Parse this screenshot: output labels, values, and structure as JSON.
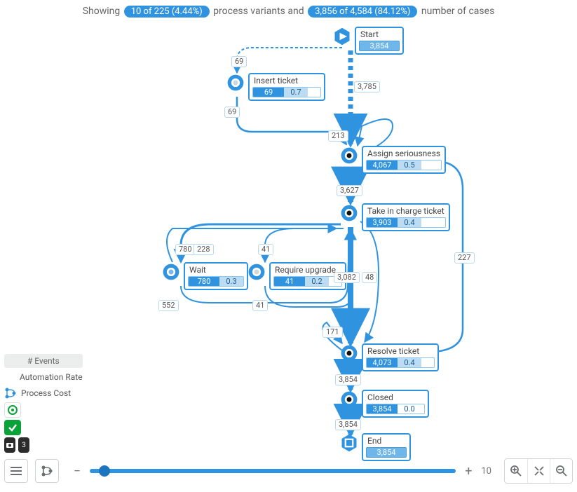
{
  "header": {
    "prefix": "Showing",
    "variants_pill": "10 of 225 (4.44%)",
    "mid": "process variants and",
    "cases_pill": "3,856 of 4,584 (84.12%)",
    "suffix": "number of cases"
  },
  "nodes": {
    "start": {
      "label": "Start",
      "count": "3,854"
    },
    "insert": {
      "label": "Insert ticket",
      "a": "69",
      "b": "0.7"
    },
    "assign": {
      "label": "Assign seriousness",
      "a": "4,067",
      "b": "0.5"
    },
    "take": {
      "label": "Take in charge ticket",
      "a": "3,903",
      "b": "0.4"
    },
    "wait": {
      "label": "Wait",
      "a": "780",
      "b": "0.3"
    },
    "upgrade": {
      "label": "Require upgrade",
      "a": "41",
      "b": "0.2"
    },
    "resolve": {
      "label": "Resolve ticket",
      "a": "4,073",
      "b": "0.4"
    },
    "closed": {
      "label": "Closed",
      "a": "3,854",
      "b": "0.0"
    },
    "end": {
      "label": "End",
      "count": "3,854"
    }
  },
  "edges": {
    "e1": "69",
    "e2": "3,785",
    "e3": "69",
    "e4": "213",
    "e5": "3,627",
    "e6": "227",
    "e7": "780",
    "e8": "228",
    "e9": "41",
    "e10": "3,082",
    "e11": "48",
    "e12": "552",
    "e13": "41",
    "e14": "171",
    "e15": "3,854",
    "e16": "3,854"
  },
  "side": {
    "events": "# Events",
    "automation": "Automation Rate",
    "cost": "Process Cost",
    "counts": "3"
  },
  "slider": {
    "value": "10"
  },
  "colors": {
    "primary": "#2f93e0"
  }
}
